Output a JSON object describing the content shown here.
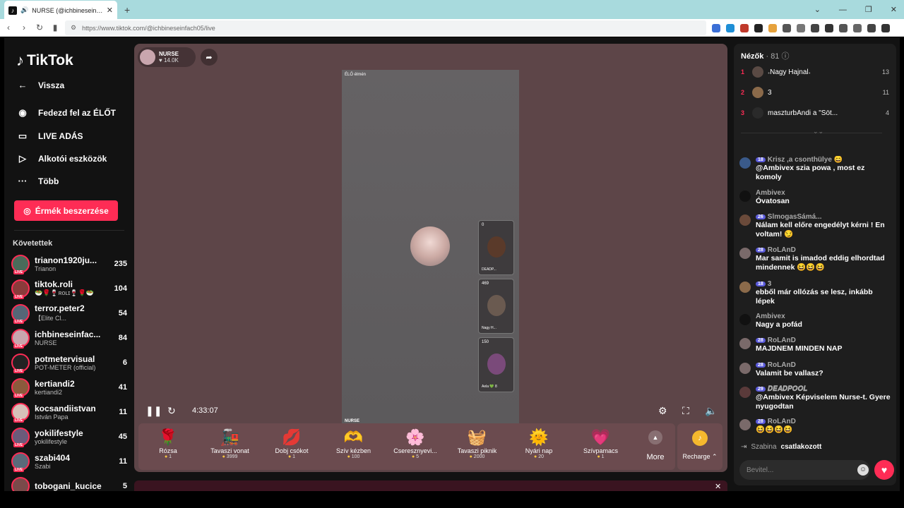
{
  "browser": {
    "tab_title": "NURSE (@ichbineseinfach05",
    "url": "https://www.tiktok.com/@ichbineseinfach05/live"
  },
  "sidebar": {
    "logo": "TikTok",
    "back": "Vissza",
    "nav": [
      "Fedezd fel az ÉLŐT",
      "LIVE ADÁS",
      "Alkotói eszközök",
      "Több"
    ],
    "coins_button": "Érmék beszerzése",
    "following_title": "Követettek",
    "following": [
      {
        "name": "trianon1920ju...",
        "sub": "Trianon",
        "count": "235",
        "color": "#4a6b5a"
      },
      {
        "name": "tiktok.roli",
        "sub": "🥗🌹🍷ʀᴏʟɪ🍷🌹🥗",
        "count": "104",
        "color": "#8a3b3b"
      },
      {
        "name": "terror.peter2",
        "sub": "【Elite Cl...",
        "count": "54",
        "color": "#556677"
      },
      {
        "name": "ichbineseinfac...",
        "sub": "NURSE",
        "count": "84",
        "color": "#c9a6ae"
      },
      {
        "name": "potmetervisual",
        "sub": "POT-METER (official)",
        "count": "6",
        "color": "#222222"
      },
      {
        "name": "kertiandi2",
        "sub": "kertiandi2",
        "count": "41",
        "color": "#8b5a3c"
      },
      {
        "name": "kocsandiistvan",
        "sub": "István Papa",
        "count": "11",
        "color": "#d6c0b8"
      },
      {
        "name": "yokilifestyle",
        "sub": "yokilifestyle",
        "count": "45",
        "color": "#6b5a7a"
      },
      {
        "name": "szabi404",
        "sub": "Szabi",
        "count": "11",
        "color": "#5a6a7a"
      },
      {
        "name": "tobogani_kucice",
        "sub": "",
        "count": "5",
        "color": "#7a4a4a"
      }
    ]
  },
  "stream": {
    "host_name": "NURSE",
    "host_likes": "♥ 14.0K",
    "top_tag": "ÉLŐ élmén",
    "bottom_tag": "NURSE",
    "guests": [
      {
        "count": "0",
        "name": "DEADP..."
      },
      {
        "count": "469",
        "name": "Nagy H..."
      },
      {
        "count": "150",
        "name": "Aela 💚 8"
      }
    ],
    "time": "4:33:07"
  },
  "gifts": [
    {
      "name": "Rózsa",
      "price": "1",
      "icon": "🌹"
    },
    {
      "name": "Tavaszi vonat",
      "price": "3999",
      "icon": "🚂"
    },
    {
      "name": "Dobj csókot",
      "price": "1",
      "icon": "💋"
    },
    {
      "name": "Szív kézben",
      "price": "100",
      "icon": "🫶"
    },
    {
      "name": "Cseresznyevi...",
      "price": "5",
      "icon": "🌸"
    },
    {
      "name": "Tavaszi piknik",
      "price": "2000",
      "icon": "🧺"
    },
    {
      "name": "Nyári nap",
      "price": "20",
      "icon": "🌞"
    },
    {
      "name": "Szívpamacs",
      "price": "1",
      "icon": "💗"
    }
  ],
  "more_label": "More",
  "recharge_label": "Recharge ⌃",
  "viewers": {
    "title": "Nézők",
    "count": "· 81",
    "top": [
      {
        "rank": "1",
        "name": "𝆹Nagy Hajnal𝆹",
        "num": "13",
        "color": "#5a4a44"
      },
      {
        "rank": "2",
        "name": "3",
        "num": "11",
        "color": "#8b6a4a"
      },
      {
        "rank": "3",
        "name": "maszturbAndi a \"Söt...",
        "num": "4",
        "color": "#2a2a2a"
      }
    ]
  },
  "chat": [
    {
      "user": "Krisz ,a csonthülye 😄",
      "badge": "18",
      "text": "@Ambivex szia powa , most ez komoly",
      "color": "#3a5a8a"
    },
    {
      "user": "Ambivex",
      "badge": "",
      "text": "Óvatosan",
      "color": "#111111"
    },
    {
      "user": "SlmogasSámá...",
      "badge": "26",
      "text": "Nálam kell előre engedélyt kérni ! En voltam! 😏",
      "color": "#6a4a3a"
    },
    {
      "user": "RoLAnD",
      "badge": "28",
      "text": "Mar samit is imadod eddig elhordtad mindennek 😆😆😆",
      "color": "#7a6a6a"
    },
    {
      "user": "3",
      "badge": "18",
      "text": "ebből már ollózás se lesz, inkább lépek",
      "color": "#8b6a4a"
    },
    {
      "user": "Ambivex",
      "badge": "",
      "text": "Nagy a pofád",
      "color": "#111111"
    },
    {
      "user": "RoLAnD",
      "badge": "28",
      "text": "MAJDNEM MINDEN NAP",
      "color": "#7a6a6a"
    },
    {
      "user": "RoLAnD",
      "badge": "28",
      "text": "Valamit be vallasz?",
      "color": "#7a6a6a"
    },
    {
      "user": "𝑫𝑬𝑨𝑫𝑷𝑶𝑶𝑳",
      "badge": "29",
      "text": "@Ambivex Képviselem Nurse-t. Gyere nyugodtan",
      "color": "#5a3a3a"
    },
    {
      "user": "RoLAnD",
      "badge": "28",
      "text": "😆😆😆😆",
      "color": "#7a6a6a"
    }
  ],
  "joined": {
    "user": "Szabina",
    "text": "csatlakozott"
  },
  "input_placeholder": "Bevitel..."
}
